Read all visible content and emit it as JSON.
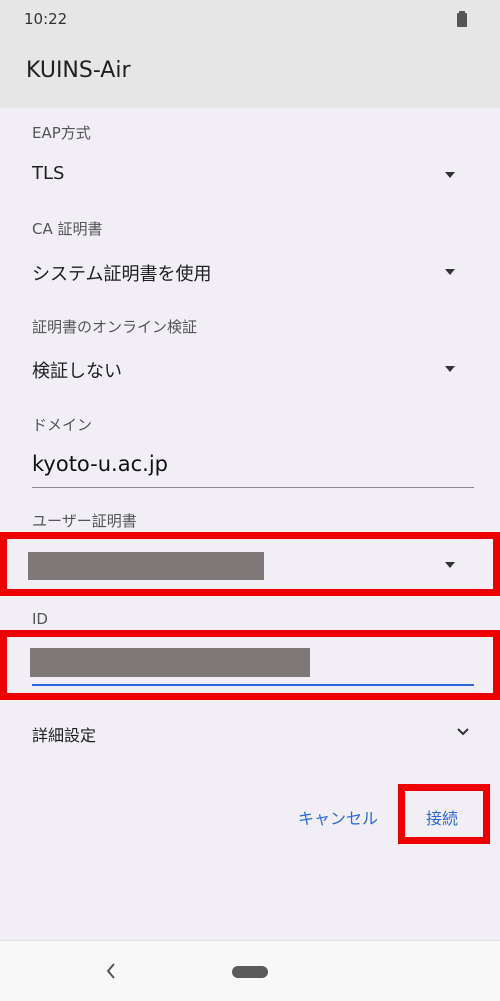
{
  "status_bar": {
    "time": "10:22",
    "battery_icon": "battery-icon"
  },
  "dialog": {
    "title": "KUINS-Air",
    "fields": {
      "eap_method": {
        "label": "EAP方式",
        "value": "TLS"
      },
      "ca_certificate": {
        "label": "CA 証明書",
        "value": "システム証明書を使用"
      },
      "online_verification": {
        "label": "証明書のオンライン検証",
        "value": "検証しない"
      },
      "domain": {
        "label": "ドメイン",
        "value": "kyoto-u.ac.jp"
      },
      "user_certificate": {
        "label": "ユーザー証明書"
      },
      "identity": {
        "label": "ID"
      }
    },
    "advanced_settings": {
      "label": "詳細設定"
    },
    "buttons": {
      "cancel": "キャンセル",
      "connect": "接続"
    }
  },
  "colors": {
    "accent": "#2b69d8",
    "highlight": "#ef0000",
    "redaction": "#7e7878"
  },
  "icons": {
    "dropdown": "caret-down-icon",
    "advanced": "chevron-down-icon",
    "back": "back-icon",
    "home": "home-pill-icon"
  }
}
